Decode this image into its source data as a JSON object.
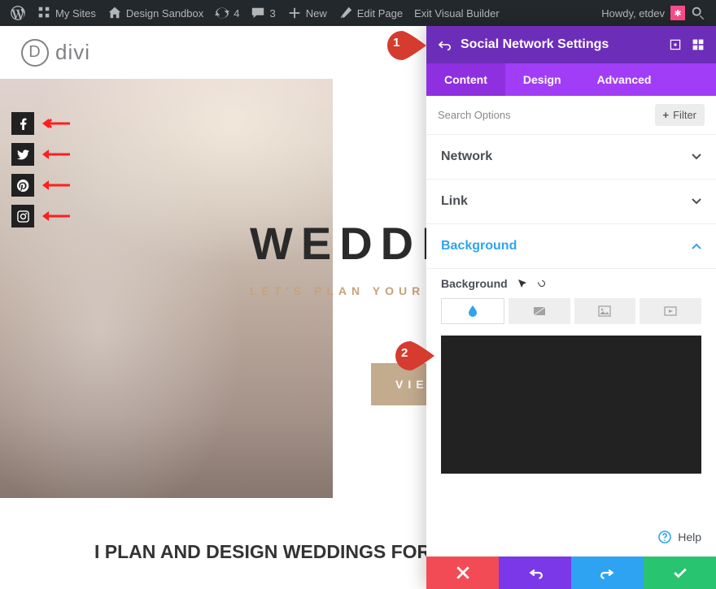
{
  "wp_bar": {
    "my_sites": "My Sites",
    "sandbox": "Design Sandbox",
    "updates_count": "4",
    "comments_count": "3",
    "new": "New",
    "edit_page": "Edit Page",
    "exit_vb": "Exit Visual Builder",
    "howdy": "Howdy, etdev"
  },
  "brand": "divi",
  "hero": {
    "title": "WEDDIN",
    "subtitle": "LET'S PLAN YOUR",
    "button": "VIEW"
  },
  "strip_heading": "I PLAN AND DESIGN WEDDINGS FOR ANY BUDGET",
  "callouts": {
    "one": "1",
    "two": "2"
  },
  "panel": {
    "title": "Social Network Settings",
    "tabs": {
      "content": "Content",
      "design": "Design",
      "advanced": "Advanced"
    },
    "search_placeholder": "Search Options",
    "filter": "Filter",
    "sections": {
      "network": "Network",
      "link": "Link",
      "background": "Background"
    },
    "bg_label": "Background",
    "help": "Help",
    "swatch_color": "#222222"
  },
  "action_colors": {
    "cancel": "#f24b55",
    "undo": "#7a38e8",
    "redo": "#2ea3f2",
    "save": "#29c46f"
  }
}
